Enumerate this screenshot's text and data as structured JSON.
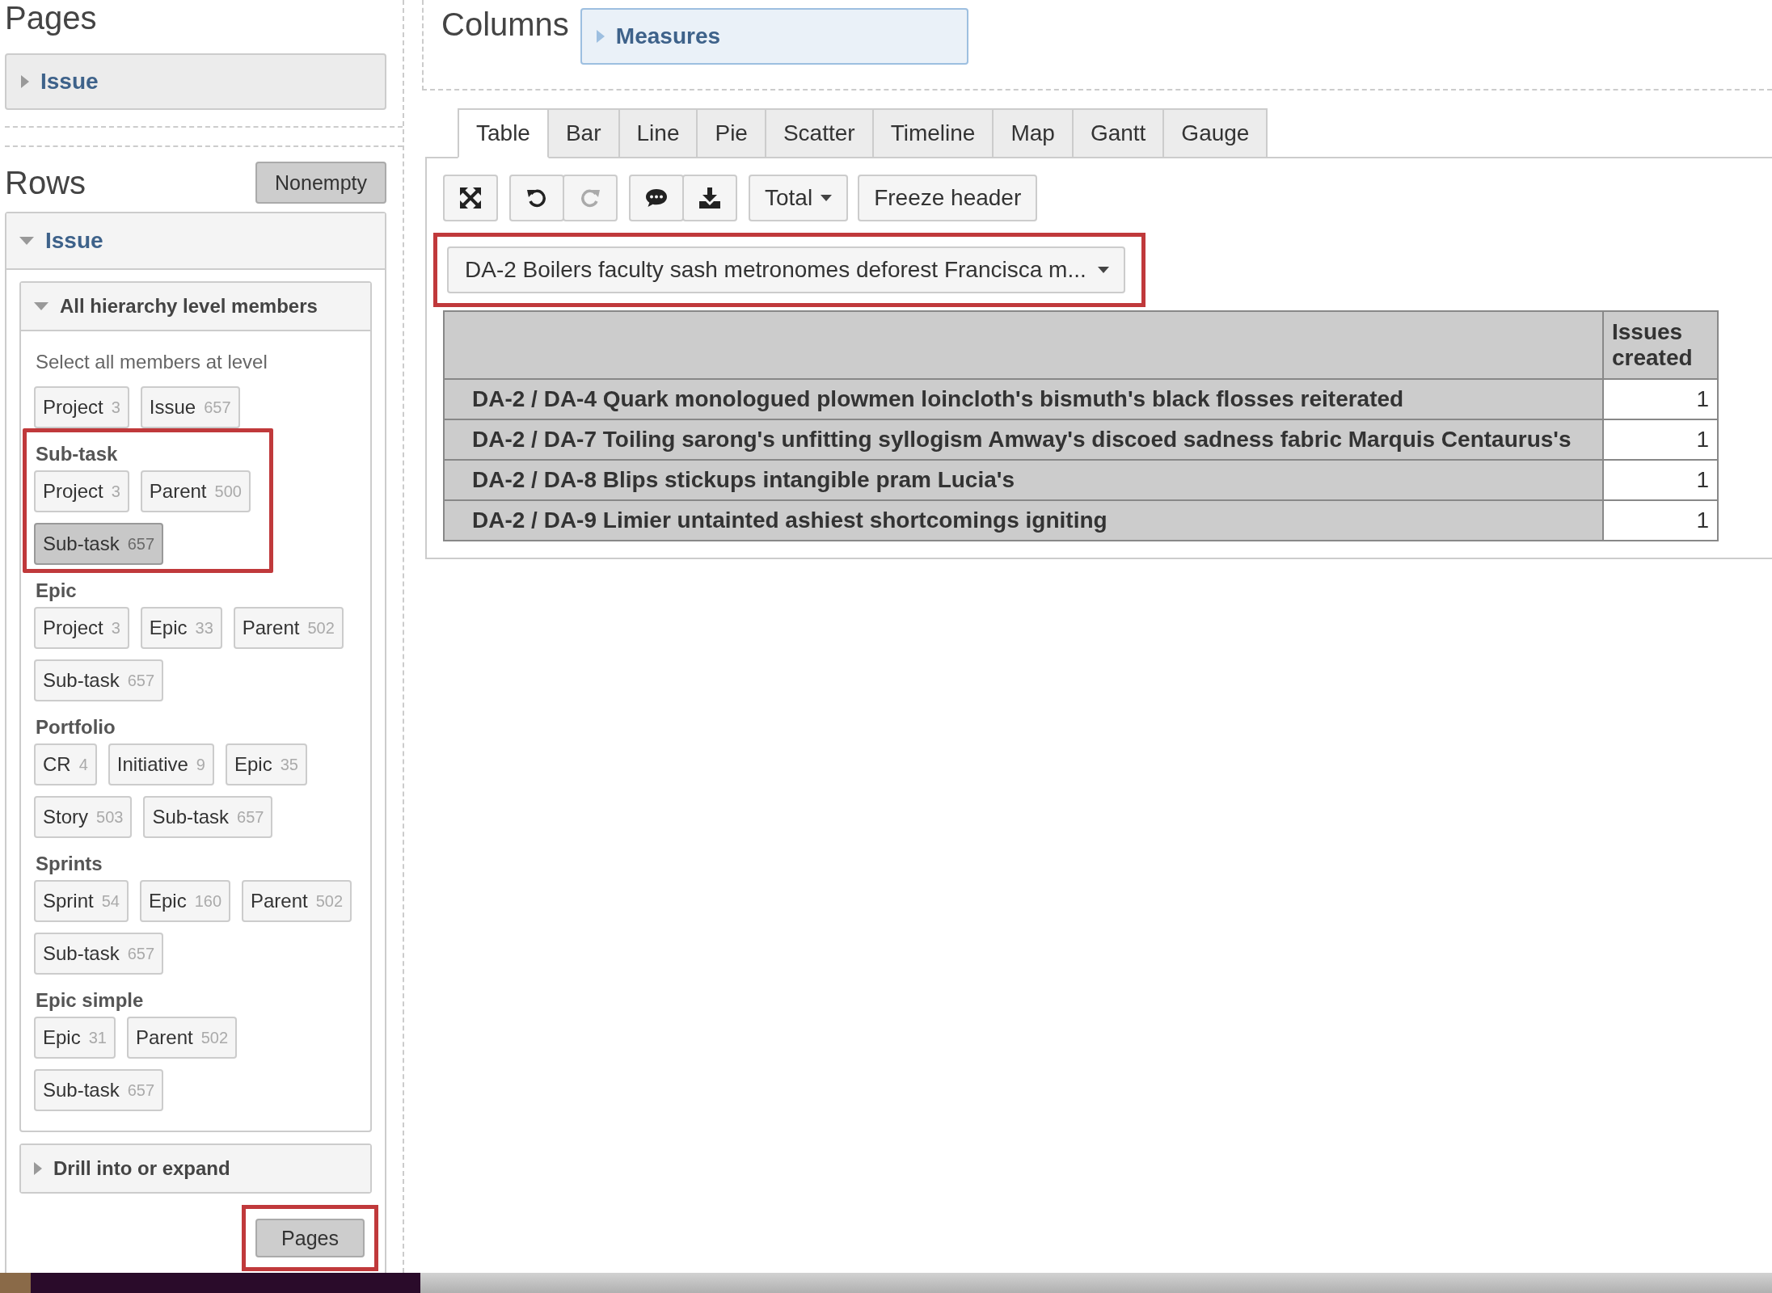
{
  "pages": {
    "title": "Pages",
    "dimension": {
      "label": "Issue",
      "expanded": false
    }
  },
  "rows": {
    "title": "Rows",
    "nonempty_button": "Nonempty",
    "dimension": {
      "label": "Issue",
      "expanded": true
    },
    "hierarchy_panel": {
      "title": "All hierarchy level members",
      "expanded": true,
      "hint": "Select all members at level",
      "groups": [
        {
          "levels": [
            {
              "label": "Project",
              "count": "3",
              "selected": false
            },
            {
              "label": "Issue",
              "count": "657",
              "selected": false
            }
          ],
          "highlighted": false
        },
        {
          "title": "Sub-task",
          "levels": [
            {
              "label": "Project",
              "count": "3",
              "selected": false
            },
            {
              "label": "Parent",
              "count": "500",
              "selected": false
            },
            {
              "label": "Sub-task",
              "count": "657",
              "selected": true
            }
          ],
          "highlighted": true
        },
        {
          "title": "Epic",
          "levels": [
            {
              "label": "Project",
              "count": "3",
              "selected": false
            },
            {
              "label": "Epic",
              "count": "33",
              "selected": false
            },
            {
              "label": "Parent",
              "count": "502",
              "selected": false
            },
            {
              "label": "Sub-task",
              "count": "657",
              "selected": false
            }
          ],
          "highlighted": false
        },
        {
          "title": "Portfolio",
          "levels": [
            {
              "label": "CR",
              "count": "4",
              "selected": false
            },
            {
              "label": "Initiative",
              "count": "9",
              "selected": false
            },
            {
              "label": "Epic",
              "count": "35",
              "selected": false
            },
            {
              "label": "Story",
              "count": "503",
              "selected": false
            },
            {
              "label": "Sub-task",
              "count": "657",
              "selected": false
            }
          ],
          "highlighted": false
        },
        {
          "title": "Sprints",
          "levels": [
            {
              "label": "Sprint",
              "count": "54",
              "selected": false
            },
            {
              "label": "Epic",
              "count": "160",
              "selected": false
            },
            {
              "label": "Parent",
              "count": "502",
              "selected": false
            },
            {
              "label": "Sub-task",
              "count": "657",
              "selected": false
            }
          ],
          "highlighted": false
        },
        {
          "title": "Epic simple",
          "levels": [
            {
              "label": "Epic",
              "count": "31",
              "selected": false
            },
            {
              "label": "Parent",
              "count": "502",
              "selected": false
            },
            {
              "label": "Sub-task",
              "count": "657",
              "selected": false
            }
          ],
          "highlighted": false
        }
      ]
    },
    "drill_panel": {
      "title": "Drill into or expand",
      "expanded": false
    },
    "pages_button": {
      "label": "Pages",
      "highlighted": true
    }
  },
  "columns": {
    "title": "Columns",
    "dimension": {
      "label": "Measures",
      "expanded": false
    }
  },
  "chart_tabs": [
    {
      "label": "Table",
      "selected": true
    },
    {
      "label": "Bar",
      "selected": false
    },
    {
      "label": "Line",
      "selected": false
    },
    {
      "label": "Pie",
      "selected": false
    },
    {
      "label": "Scatter",
      "selected": false
    },
    {
      "label": "Timeline",
      "selected": false
    },
    {
      "label": "Map",
      "selected": false
    },
    {
      "label": "Gantt",
      "selected": false
    },
    {
      "label": "Gauge",
      "selected": false
    }
  ],
  "toolbar": {
    "undo_disabled": false,
    "redo_disabled": true,
    "total": "Total",
    "freeze_header": "Freeze header"
  },
  "page_selector": {
    "value": "DA-2 Boilers faculty sash metronomes deforest Francisca m...",
    "highlighted": true
  },
  "table": {
    "columns": [
      "Issues created"
    ],
    "rows": [
      {
        "label": "DA-2 / DA-4 Quark monologued plowmen loincloth's bismuth's black flosses reiterated",
        "value": "1"
      },
      {
        "label": "DA-2 / DA-7 Toiling sarong's unfitting syllogism Amway's discoed sadness fabric Marquis Centaurus's",
        "value": "1"
      },
      {
        "label": "DA-2 / DA-8 Blips stickups intangible pram Lucia's",
        "value": "1"
      },
      {
        "label": "DA-2 / DA-9 Limier untainted ashiest shortcomings igniting",
        "value": "1"
      }
    ]
  }
}
